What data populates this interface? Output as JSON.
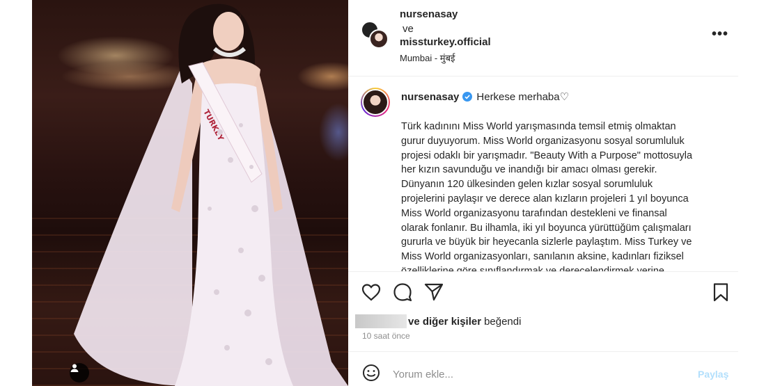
{
  "post": {
    "owner": "nursenasay",
    "conjunction": "ve",
    "coowner": "missturkey.official",
    "location": "Mumbai - मुंबई",
    "more_label": "•••"
  },
  "photo": {
    "sash_text": "TURKEY",
    "next_label": "›"
  },
  "caption": {
    "username": "nursenasay",
    "greeting": "Herkese merhaba♡",
    "lines": [
      "Türk kadınını Miss World yarışmasında temsil etmiş olmaktan",
      "gurur duyuyorum. Miss World organizasyonu sosyal sorumluluk",
      "projesi odaklı bir yarışmadır. \"Beauty With a Purpose\" mottosuyla",
      "her kızın savunduğu ve inandığı bir amacı olması gerekir.",
      "Dünyanın 120 ülkesinden gelen kızlar sosyal sorumluluk",
      "projelerini paylaşır ve derece alan kızların projeleri 1 yıl boyunca",
      "Miss World organizasyonu tarafından destekleni ve finansal",
      "olarak fonlanır. Bu ilhamla, iki yıl boyunca yürüttüğüm çalışmaları",
      "gururla ve büyük bir heyecanla sizlerle paylaştım. Miss Turkey ve",
      "Miss World organizasyonları, sanılanın aksine, kadınları fiziksel",
      "özelliklerine göre sınıflandırmak ve derecelendirmek yerine"
    ]
  },
  "likes": {
    "others": "ve diğer kişiler",
    "liked": "beğendi"
  },
  "timestamp": "10 saat önce",
  "comment": {
    "placeholder": "Yorum ekle...",
    "post_label": "Paylaş"
  },
  "colors": {
    "text": "#262626",
    "muted": "#8e8e8e",
    "post_disabled": "#b2dffc",
    "verified": "#3897f0"
  },
  "icons": [
    "heart-icon",
    "comment-icon",
    "share-icon",
    "bookmark-icon",
    "emoji-icon",
    "verified-icon",
    "more-icon",
    "chevron-right-icon",
    "user-tag-icon"
  ]
}
